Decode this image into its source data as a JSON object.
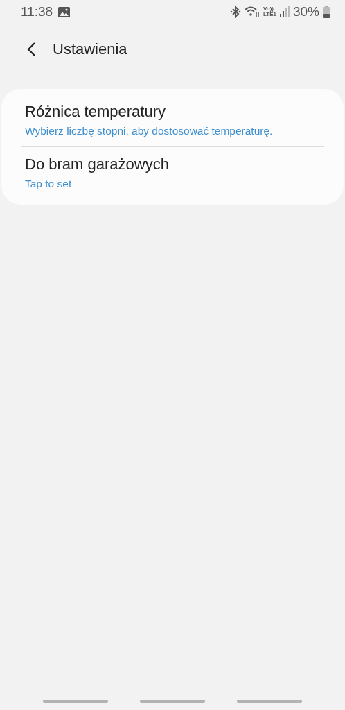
{
  "status_bar": {
    "time": "11:38",
    "network_top": "Vo))",
    "network_bottom": "LTE1",
    "battery": "30%"
  },
  "header": {
    "title": "Ustawienia"
  },
  "settings": [
    {
      "title": "Różnica temperatury",
      "subtitle": "Wybierz liczbę stopni, aby dostosować temperaturę."
    },
    {
      "title": "Do bram garażowych",
      "subtitle": "Tap to set"
    }
  ]
}
